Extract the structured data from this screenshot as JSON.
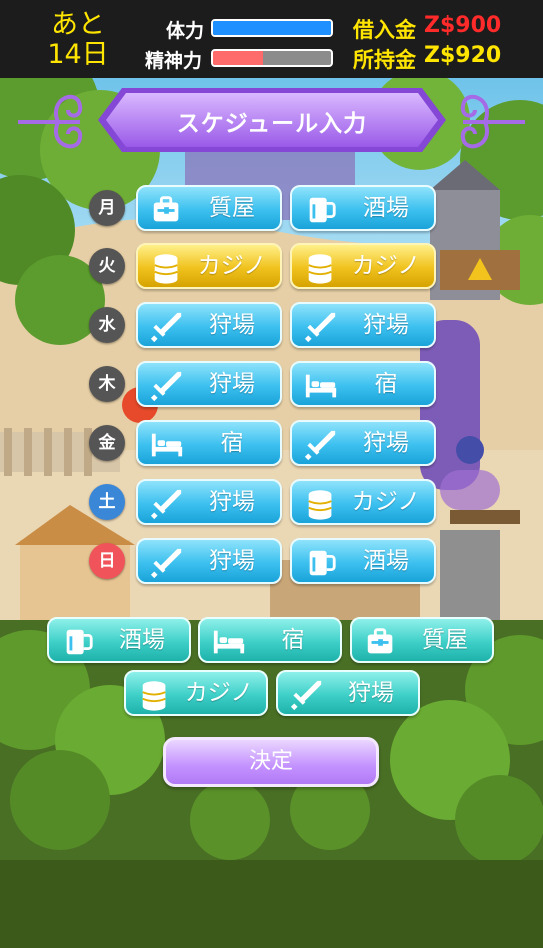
{
  "status": {
    "days_line1": "あと",
    "days_line2": "14日",
    "stamina_label": "体力",
    "stamina_level": 1.0,
    "mind_label": "精神力",
    "mind_level": 0.42,
    "debt_label": "借入金",
    "debt_value": "Z$900",
    "money_label": "所持金",
    "money_value": "Z$920",
    "colors": {
      "stamina": "#1e90ff",
      "mind": "#ff6b6b",
      "debt": "#ff2a2a",
      "money": "#ffe500"
    }
  },
  "banner": {
    "title": "スケジュール入力"
  },
  "schedule": [
    {
      "day": "月",
      "slots": [
        {
          "label": "質屋",
          "icon": "pawnshop-icon"
        },
        {
          "label": "酒場",
          "icon": "beer-mug-icon"
        }
      ]
    },
    {
      "day": "火",
      "slots": [
        {
          "label": "カジノ",
          "icon": "coin-stack-icon"
        },
        {
          "label": "カジノ",
          "icon": "coin-stack-icon"
        }
      ]
    },
    {
      "day": "水",
      "slots": [
        {
          "label": "狩場",
          "icon": "sword-icon"
        },
        {
          "label": "狩場",
          "icon": "sword-icon"
        }
      ]
    },
    {
      "day": "木",
      "slots": [
        {
          "label": "狩場",
          "icon": "sword-icon"
        },
        {
          "label": "宿",
          "icon": "bed-icon"
        }
      ]
    },
    {
      "day": "金",
      "slots": [
        {
          "label": "宿",
          "icon": "bed-icon"
        },
        {
          "label": "狩場",
          "icon": "sword-icon"
        }
      ]
    },
    {
      "day": "土",
      "slots": [
        {
          "label": "狩場",
          "icon": "sword-icon"
        },
        {
          "label": "カジノ",
          "icon": "coin-stack-icon"
        }
      ]
    },
    {
      "day": "日",
      "slots": [
        {
          "label": "狩場",
          "icon": "sword-icon"
        },
        {
          "label": "酒場",
          "icon": "beer-mug-icon"
        }
      ]
    }
  ],
  "palette": [
    {
      "label": "酒場",
      "icon": "beer-mug-icon"
    },
    {
      "label": "宿",
      "icon": "bed-icon"
    },
    {
      "label": "質屋",
      "icon": "pawnshop-icon"
    },
    {
      "label": "カジノ",
      "icon": "coin-stack-icon"
    },
    {
      "label": "狩場",
      "icon": "sword-icon"
    }
  ],
  "confirm_label": "決定"
}
